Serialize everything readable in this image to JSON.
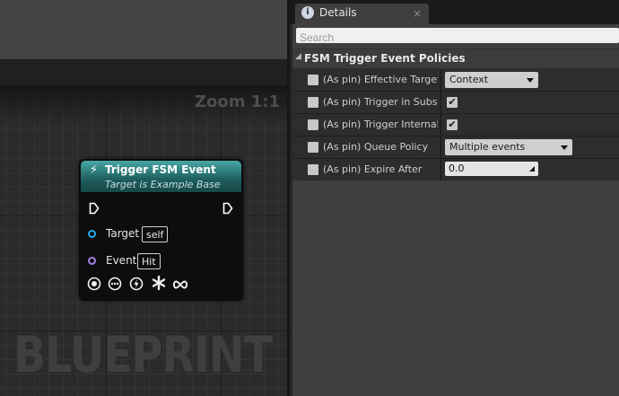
{
  "graph": {
    "zoom_label": "Zoom 1:1",
    "watermark": "BLUEPRINT",
    "node": {
      "title": "Trigger FSM Event",
      "subtitle": "Target is Example Base",
      "header_color": "#1f6a69",
      "pins": [
        {
          "label": "Target",
          "value": "self",
          "pin_color": "#2aa8e8"
        },
        {
          "label": "Event",
          "value": "Hit",
          "pin_color": "#a97ee6"
        }
      ],
      "icons": [
        "circle-dot-icon",
        "ellipsis-circle-icon",
        "lightning-circle-icon",
        "asterisk-icon",
        "infinity-icon"
      ]
    }
  },
  "details": {
    "tab_label": "Details",
    "tab_close": "×",
    "search_placeholder": "Search",
    "category": "FSM Trigger Event Policies",
    "properties": [
      {
        "label": "(As pin)  Effective Target",
        "type": "dropdown",
        "value": "Context Object"
      },
      {
        "label": "(As pin)  Trigger in Substate",
        "type": "checkbox",
        "value": "✔"
      },
      {
        "label": "(As pin)  Trigger Internal Events",
        "type": "checkbox",
        "value": "✔"
      },
      {
        "label": "(As pin)  Queue Policy",
        "type": "dropdown",
        "value": "Multiple events allowed"
      },
      {
        "label": "(As pin)  Expire After",
        "type": "number",
        "value": "0.0"
      }
    ]
  }
}
